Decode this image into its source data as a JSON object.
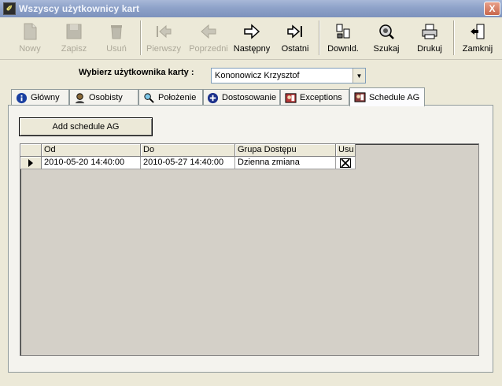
{
  "window": {
    "title": "Wszyscy użytkownicy kart",
    "close_label": "X"
  },
  "toolbar": {
    "buttons": [
      {
        "label": "Nowy",
        "icon": "new-document-icon",
        "enabled": false
      },
      {
        "label": "Zapisz",
        "icon": "save-icon",
        "enabled": false
      },
      {
        "label": "Usuń",
        "icon": "delete-bin-icon",
        "enabled": false
      },
      {
        "label": "Pierwszy",
        "icon": "first-record-icon",
        "enabled": false
      },
      {
        "label": "Poprzedni",
        "icon": "previous-record-icon",
        "enabled": false
      },
      {
        "label": "Następny",
        "icon": "next-record-icon",
        "enabled": true
      },
      {
        "label": "Ostatni",
        "icon": "last-record-icon",
        "enabled": true
      },
      {
        "label": "Downld.",
        "icon": "download-icon",
        "enabled": true
      },
      {
        "label": "Szukaj",
        "icon": "search-icon",
        "enabled": true
      },
      {
        "label": "Drukuj",
        "icon": "printer-icon",
        "enabled": true
      },
      {
        "label": "Zamknij",
        "icon": "exit-door-icon",
        "enabled": true
      }
    ]
  },
  "user_select": {
    "label": "Wybierz użytkownika karty :",
    "value": "Kononowicz Krzysztof"
  },
  "tabs": [
    {
      "label": "Główny",
      "icon": "info-icon",
      "active": false
    },
    {
      "label": "Osobisty",
      "icon": "person-icon",
      "active": false
    },
    {
      "label": "Położenie",
      "icon": "location-icon",
      "active": false
    },
    {
      "label": "Dostosowanie",
      "icon": "plus-circle-icon",
      "active": false
    },
    {
      "label": "Exceptions",
      "icon": "exceptions-icon",
      "active": false
    },
    {
      "label": "Schedule AG",
      "icon": "schedule-icon",
      "active": true
    }
  ],
  "schedule": {
    "add_button_label": "Add schedule AG",
    "columns": [
      "Od",
      "Do",
      "Grupa Dostępu",
      "Usu"
    ],
    "rows": [
      {
        "od": "2010-05-20 14:40:00",
        "do": "2010-05-27 14:40:00",
        "grupa": "Dzienna zmiana",
        "usun": true
      }
    ]
  },
  "colors": {
    "titlebar": "#8ea2c9",
    "face": "#ece9d8",
    "panel": "#f4f3ee",
    "grid_bg": "#d4d0c8"
  }
}
